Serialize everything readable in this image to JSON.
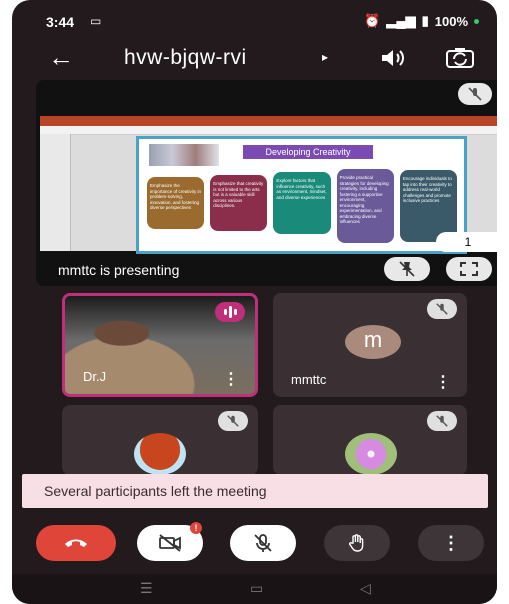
{
  "status_bar": {
    "time": "3:44",
    "battery": "100%"
  },
  "header": {
    "meeting_code": "hvw-bjqw-rvi",
    "caret": "▸"
  },
  "presentation": {
    "slide_title": "Developing Creativity",
    "boxes": [
      "Emphasize the importance of creativity in problem-solving, innovation, and fostering diverse perspectives",
      "Emphasize that creativity is not limited to the arts but is a valuable skill across various disciplines.",
      "Explore factors that influence creativity, such as environment, mindset, and diverse experiences",
      "Provide practical strategies for developing creativity, including fostering a supportive environment, encouraging experimentation, and embracing diverse influences",
      "Encourage individuals to tap into their creativity to address real-world challenges and promote inclusive practices"
    ],
    "page_number": "1",
    "presenter_text": "mmttc is presenting"
  },
  "participants": [
    {
      "name": "Dr.J",
      "speaking": true
    },
    {
      "name": "mmttc",
      "avatar_letter": "m",
      "muted": true
    },
    {
      "name": "",
      "muted": true
    },
    {
      "name": "",
      "muted": true
    }
  ],
  "toast": {
    "message": "Several participants left the meeting"
  },
  "controls": {
    "camera_badge": "!"
  },
  "colors": {
    "background": "#221a1c",
    "end_call": "#e0453a",
    "speaking_accent": "#c0307a",
    "toast_bg": "#f7dfe5"
  }
}
